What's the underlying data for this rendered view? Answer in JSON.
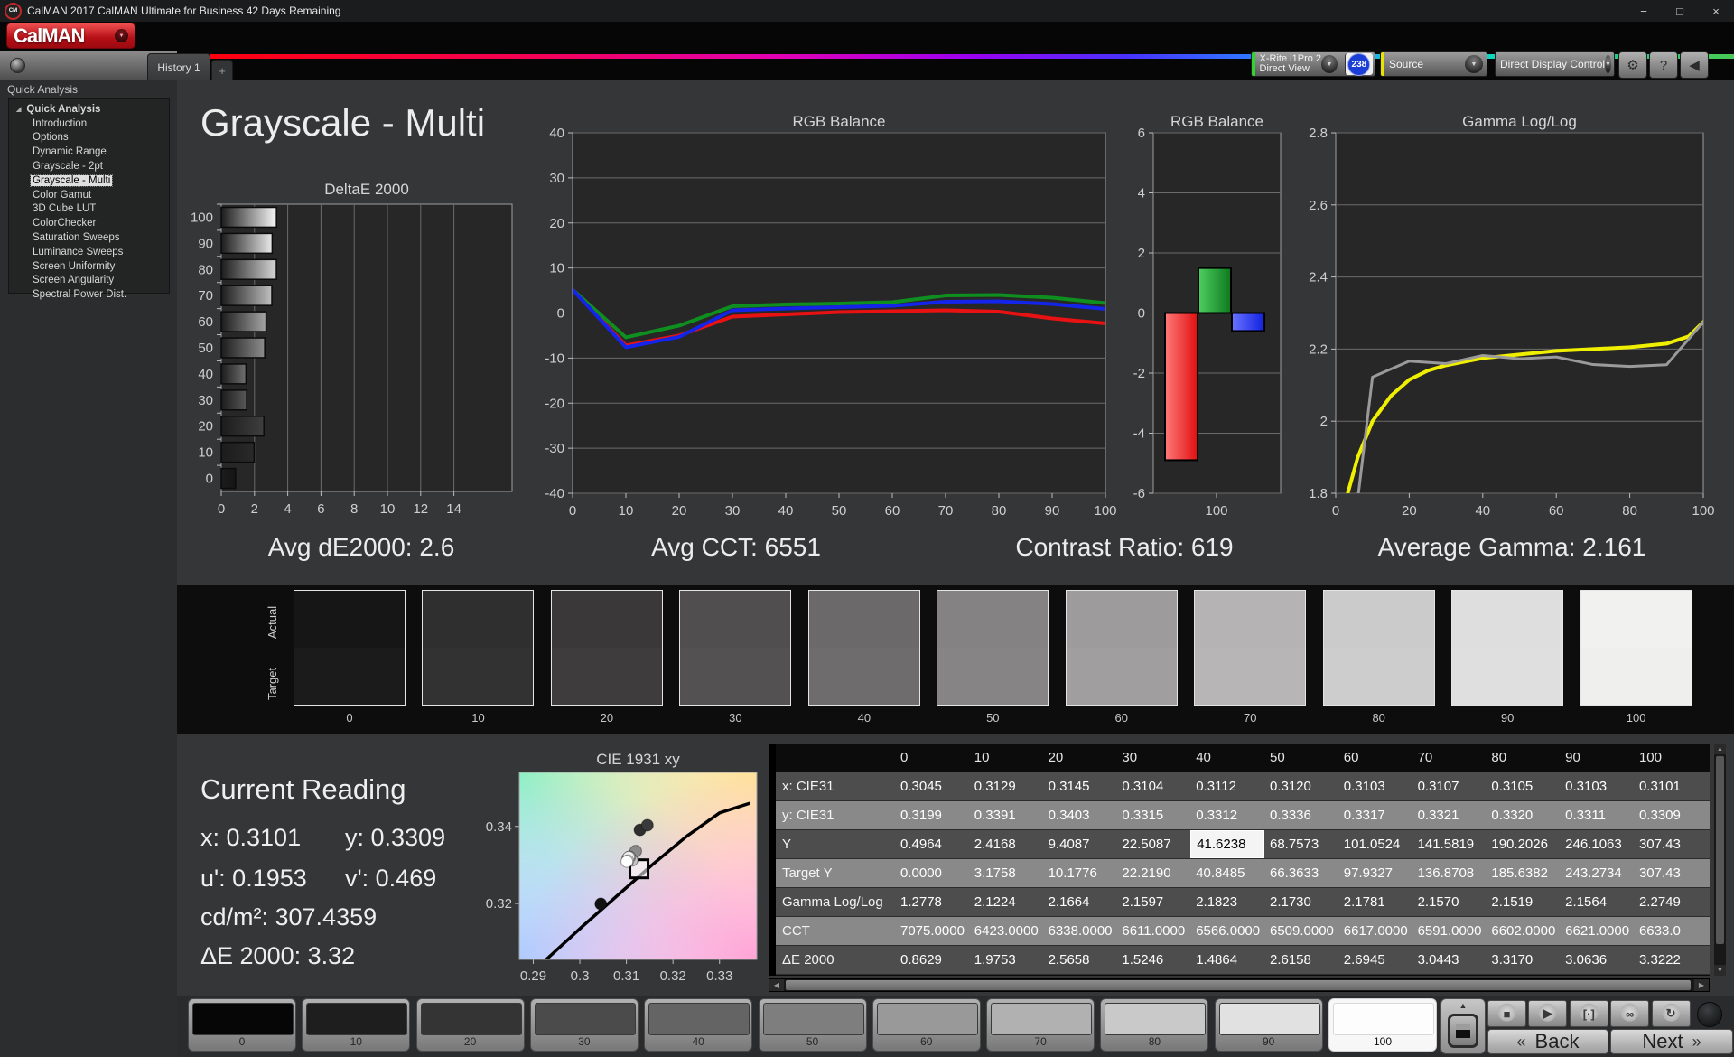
{
  "window": {
    "title": "CalMAN 2017 CalMAN Ultimate for Business 42 Days Remaining"
  },
  "icons": {
    "minimize": "−",
    "maximize": "□",
    "close": "×",
    "app_badge": "CM",
    "dropdown_arrow": "▼",
    "collapse_left": "◀",
    "gear": "⚙",
    "help": "?",
    "tree_expand": "◢",
    "scroll_left": "◀",
    "scroll_right": "▶",
    "scroll_up": "▲",
    "scroll_down": "▼",
    "patch_up": "▲",
    "back_chevron": "«",
    "next_chevron": "»"
  },
  "logo": {
    "text": "CalMAN"
  },
  "tabs": {
    "history": "History 1",
    "add": "+"
  },
  "toolbar": {
    "meter_line1": "X-Rite i1Pro 2",
    "meter_line2": "Direct View",
    "meter_badge": "238",
    "source_label": "Source",
    "display_label": "Direct Display Control",
    "accent_green": "#2fd42f",
    "accent_yellow": "#e8e400",
    "badge_blue": "#1b3ed6"
  },
  "sidebar": {
    "header": "Quick Analysis",
    "root_label": "Quick Analysis",
    "items": [
      {
        "label": "Introduction"
      },
      {
        "label": "Options"
      },
      {
        "label": "Dynamic Range"
      },
      {
        "label": "Grayscale - 2pt"
      },
      {
        "label": "Grayscale - Multi",
        "selected": true
      },
      {
        "label": "Color Gamut"
      },
      {
        "label": "3D Cube LUT"
      },
      {
        "label": "ColorChecker"
      },
      {
        "label": "Saturation Sweeps"
      },
      {
        "label": "Luminance Sweeps"
      },
      {
        "label": "Screen Uniformity"
      },
      {
        "label": "Screen Angularity"
      },
      {
        "label": "Spectral Power Dist."
      }
    ]
  },
  "page": {
    "title": "Grayscale - Multi"
  },
  "stats": [
    "Avg dE2000: 2.6",
    "Avg CCT: 6551",
    "Contrast Ratio: 619",
    "Average Gamma: 2.161"
  ],
  "chart_data": [
    {
      "id": "delta-e-2000",
      "type": "bar",
      "orientation": "horizontal",
      "title": "DeltaE 2000",
      "categories": [
        "100",
        "90",
        "80",
        "70",
        "60",
        "50",
        "40",
        "30",
        "20",
        "10",
        "0"
      ],
      "values": [
        3.3222,
        3.0636,
        3.317,
        3.0443,
        2.6945,
        2.6158,
        1.4864,
        1.5246,
        2.5658,
        1.9753,
        0.8629
      ],
      "bar_colors": [
        "#f8f8f8",
        "#e9e9e9",
        "#d6d6d6",
        "#bfbfbf",
        "#a5a5a5",
        "#8d8d8d",
        "#707070",
        "#585858",
        "#3f3f3f",
        "#2a2a2a",
        "#151515"
      ],
      "xlim": [
        0,
        17.5
      ],
      "xticks": [
        0,
        2,
        4,
        6,
        8,
        10,
        12,
        14
      ],
      "grid": true
    },
    {
      "id": "rgb-balance-line",
      "type": "line",
      "title": "RGB Balance",
      "x": [
        0,
        10,
        20,
        30,
        40,
        50,
        60,
        70,
        80,
        90,
        100
      ],
      "xlim": [
        0,
        100
      ],
      "ylim": [
        -40,
        40
      ],
      "yticks": [
        "40",
        "30",
        "20",
        "10",
        "0",
        "-10",
        "-20",
        "-30",
        "-40"
      ],
      "xticks": [
        "0",
        "10",
        "20",
        "30",
        "40",
        "50",
        "60",
        "70",
        "80",
        "90",
        "100"
      ],
      "series": [
        {
          "name": "Red",
          "color": "#e81212",
          "values": [
            5.2,
            -7.2,
            -5.0,
            -0.8,
            -0.3,
            0.2,
            0.4,
            0.6,
            0.3,
            -1.2,
            -2.3
          ]
        },
        {
          "name": "Green",
          "color": "#0f8f1f",
          "values": [
            5.2,
            -5.4,
            -2.8,
            1.5,
            1.9,
            2.1,
            2.4,
            3.9,
            4.0,
            3.4,
            2.2
          ]
        },
        {
          "name": "Blue",
          "color": "#1424e8",
          "values": [
            5.2,
            -7.6,
            -5.3,
            0.6,
            1.0,
            1.3,
            1.6,
            2.5,
            2.6,
            2.0,
            0.9
          ]
        }
      ]
    },
    {
      "id": "rgb-balance-bar",
      "type": "bar",
      "orientation": "vertical",
      "title": "RGB Balance",
      "categories": [
        "Red",
        "Green",
        "Blue"
      ],
      "values": [
        -4.9,
        1.5,
        -0.6
      ],
      "bar_colors": [
        "#e01010",
        "#0c7a1c",
        "#1020e0"
      ],
      "bar_colors_light": [
        "#ff7a7a",
        "#4fce63",
        "#6a74ff"
      ],
      "ylim": [
        -6,
        6
      ],
      "yticks": [
        "6",
        "4",
        "2",
        "0",
        "-2",
        "-4",
        "-6"
      ],
      "xticks": [
        "100"
      ]
    },
    {
      "id": "gamma-loglog",
      "type": "line",
      "title": "Gamma Log/Log",
      "xlim": [
        0,
        100
      ],
      "ylim": [
        1.8,
        2.8
      ],
      "yticks": [
        "2.8",
        "2.6",
        "2.4",
        "2.2",
        "2",
        "1.8"
      ],
      "xticks": [
        "0",
        "20",
        "40",
        "60",
        "80",
        "100"
      ],
      "series": [
        {
          "name": "Target",
          "color": "#f0ef00",
          "width": 4,
          "x": [
            3,
            6,
            10,
            15,
            20,
            25,
            30,
            40,
            50,
            60,
            70,
            80,
            90,
            96,
            100
          ],
          "values": [
            1.79,
            1.9,
            2.0,
            2.07,
            2.115,
            2.14,
            2.155,
            2.175,
            2.185,
            2.195,
            2.2,
            2.205,
            2.215,
            2.235,
            2.275
          ]
        },
        {
          "name": "Measured",
          "color": "#9a9a9a",
          "width": 3,
          "x": [
            0,
            10,
            20,
            30,
            40,
            50,
            60,
            70,
            80,
            90,
            100
          ],
          "values": [
            1.2778,
            2.1224,
            2.1664,
            2.1597,
            2.1823,
            2.173,
            2.1781,
            2.157,
            2.1519,
            2.1564,
            2.2749
          ]
        }
      ]
    },
    {
      "id": "cie-1931-xy",
      "type": "scatter",
      "title": "CIE 1931 xy",
      "xlim": [
        0.287,
        0.338
      ],
      "ylim": [
        0.3055,
        0.354
      ],
      "xticks": [
        "0.29",
        "0.3",
        "0.31",
        "0.32",
        "0.33"
      ],
      "yticks": [
        "0.34",
        "0.32"
      ],
      "locus": [
        [
          0.2928,
          0.3055
        ],
        [
          0.3005,
          0.314
        ],
        [
          0.308,
          0.322
        ],
        [
          0.3155,
          0.33
        ],
        [
          0.323,
          0.3375
        ],
        [
          0.33,
          0.3435
        ],
        [
          0.3365,
          0.346
        ]
      ],
      "points": [
        {
          "x": 0.3045,
          "y": 0.3199,
          "fill": "#111111"
        },
        {
          "x": 0.3129,
          "y": 0.3391,
          "fill": "#2e2e2e"
        },
        {
          "x": 0.3145,
          "y": 0.3403,
          "fill": "#3a3a3a"
        },
        {
          "x": 0.312,
          "y": 0.3336,
          "fill": "#8a8a8a"
        },
        {
          "x": 0.3104,
          "y": 0.3315,
          "fill": "#cfcfcf"
        },
        {
          "x": 0.3112,
          "y": 0.3312,
          "fill": "#c4c4c4"
        },
        {
          "x": 0.3103,
          "y": 0.3317,
          "fill": "#e4e4e4"
        },
        {
          "x": 0.3107,
          "y": 0.3321,
          "fill": "#bdbdbd"
        },
        {
          "x": 0.3105,
          "y": 0.332,
          "fill": "#efefef"
        },
        {
          "x": 0.3103,
          "y": 0.3311,
          "fill": "#f6f6f6"
        },
        {
          "x": 0.3101,
          "y": 0.3309,
          "fill": "#ffffff"
        }
      ],
      "target": {
        "x": 0.3127,
        "y": 0.329
      }
    }
  ],
  "swatch_strip": {
    "row_labels": [
      "Actual",
      "Target"
    ],
    "levels": [
      {
        "label": "0",
        "actual": "#161616",
        "target": "#1b1b1b"
      },
      {
        "label": "10",
        "actual": "#2f2f2f",
        "target": "#323232"
      },
      {
        "label": "20",
        "actual": "#3a3839",
        "target": "#3e3c3d"
      },
      {
        "label": "30",
        "actual": "#504e4f",
        "target": "#535152"
      },
      {
        "label": "40",
        "actual": "#6b696a",
        "target": "#6e6c6d"
      },
      {
        "label": "50",
        "actual": "#848283",
        "target": "#868485"
      },
      {
        "label": "60",
        "actual": "#9d9b9c",
        "target": "#a09e9f"
      },
      {
        "label": "70",
        "actual": "#b5b3b4",
        "target": "#b7b5b6"
      },
      {
        "label": "80",
        "actual": "#cbcbcb",
        "target": "#cdcdcd"
      },
      {
        "label": "90",
        "actual": "#dedede",
        "target": "#dfdfdf"
      },
      {
        "label": "100",
        "actual": "#f1f2f0",
        "target": "#eff0ee"
      }
    ]
  },
  "current_reading": {
    "title": "Current Reading",
    "x": "x: 0.3101",
    "y": "y: 0.3309",
    "u": "u': 0.1953",
    "v": "v': 0.469",
    "cd": "cd/m²: 307.4359",
    "de": "ΔE 2000: 3.32"
  },
  "table": {
    "columns": [
      "0",
      "10",
      "20",
      "30",
      "40",
      "50",
      "60",
      "70",
      "80",
      "90",
      "100"
    ],
    "rows": [
      {
        "label": "x: CIE31",
        "values": [
          "0.3045",
          "0.3129",
          "0.3145",
          "0.3104",
          "0.3112",
          "0.3120",
          "0.3103",
          "0.3107",
          "0.3105",
          "0.3103",
          "0.3101"
        ]
      },
      {
        "label": "y: CIE31",
        "values": [
          "0.3199",
          "0.3391",
          "0.3403",
          "0.3315",
          "0.3312",
          "0.3336",
          "0.3317",
          "0.3321",
          "0.3320",
          "0.3311",
          "0.3309"
        ]
      },
      {
        "label": "Y",
        "values": [
          "0.4964",
          "2.4168",
          "9.4087",
          "22.5087",
          "41.6238",
          "68.7573",
          "101.0524",
          "141.5819",
          "190.2026",
          "246.1063",
          "307.43"
        ]
      },
      {
        "label": "Target Y",
        "values": [
          "0.0000",
          "3.1758",
          "10.1776",
          "22.2190",
          "40.8485",
          "66.3633",
          "97.9327",
          "136.8708",
          "185.6382",
          "243.2734",
          "307.43"
        ]
      },
      {
        "label": "Gamma Log/Log",
        "values": [
          "1.2778",
          "2.1224",
          "2.1664",
          "2.1597",
          "2.1823",
          "2.1730",
          "2.1781",
          "2.1570",
          "2.1519",
          "2.1564",
          "2.2749"
        ]
      },
      {
        "label": "CCT",
        "values": [
          "7075.0000",
          "6423.0000",
          "6338.0000",
          "6611.0000",
          "6566.0000",
          "6509.0000",
          "6617.0000",
          "6591.0000",
          "6602.0000",
          "6621.0000",
          "6633.0"
        ]
      },
      {
        "label": "ΔE 2000",
        "values": [
          "0.8629",
          "1.9753",
          "2.5658",
          "1.5246",
          "1.4864",
          "2.6158",
          "2.6945",
          "3.0443",
          "3.3170",
          "3.0636",
          "3.3222"
        ]
      }
    ],
    "highlight_cell": {
      "row": 2,
      "col": 4
    }
  },
  "patch_bar": {
    "patches": [
      {
        "label": "0",
        "color": "#060606"
      },
      {
        "label": "10",
        "color": "#1e1e1e"
      },
      {
        "label": "20",
        "color": "#343434"
      },
      {
        "label": "30",
        "color": "#4b4b4b"
      },
      {
        "label": "40",
        "color": "#646464"
      },
      {
        "label": "50",
        "color": "#7e7e7e"
      },
      {
        "label": "60",
        "color": "#999999"
      },
      {
        "label": "70",
        "color": "#b1b1b1"
      },
      {
        "label": "80",
        "color": "#c9c9c9"
      },
      {
        "label": "90",
        "color": "#e1e1e1"
      },
      {
        "label": "100",
        "color": "#fdfdfd",
        "selected": true
      }
    ],
    "transport": [
      {
        "name": "stop-button",
        "glyph": "■"
      },
      {
        "name": "play-button",
        "glyph": "▶"
      },
      {
        "name": "single-measure-button",
        "glyph": "[·]"
      },
      {
        "name": "continuous-measure-button",
        "glyph": "∞"
      },
      {
        "name": "refresh-button",
        "glyph": "↻"
      }
    ],
    "back_label": "Back",
    "next_label": "Next"
  }
}
